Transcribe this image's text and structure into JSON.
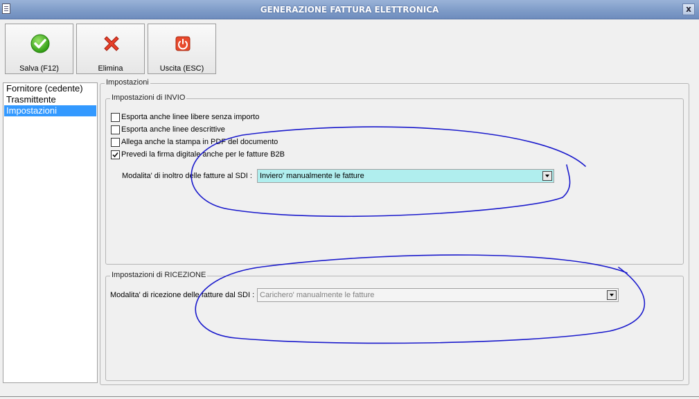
{
  "window": {
    "title": "GENERAZIONE FATTURA ELETTRONICA",
    "close_label": "x"
  },
  "toolbar": {
    "save_label": "Salva (F12)",
    "delete_label": "Elimina",
    "exit_label": "Uscita (ESC)"
  },
  "nav": {
    "items": [
      {
        "label": "Fornitore (cedente)",
        "selected": false
      },
      {
        "label": "Trasmittente",
        "selected": false
      },
      {
        "label": "Impostazioni",
        "selected": true
      }
    ]
  },
  "settings": {
    "group_title": "Impostazioni",
    "invio": {
      "title": "Impostazioni di INVIO",
      "options": [
        {
          "label": "Esporta anche linee libere senza importo",
          "checked": false
        },
        {
          "label": "Esporta anche linee descrittive",
          "checked": false
        },
        {
          "label": "Allega anche la stampa in PDF del documento",
          "checked": false
        },
        {
          "label": "Prevedi la firma digitale anche per le fatture B2B",
          "checked": true
        }
      ],
      "mode_label": "Modalita' di inoltro delle fatture al SDI :",
      "mode_value": "Inviero' manualmente le fatture"
    },
    "ricezione": {
      "title": "Impostazioni di RICEZIONE",
      "mode_label": "Modalita' di ricezione delle fatture dal SDI :",
      "mode_value": "Carichero' manualmente le fatture"
    }
  },
  "colors": {
    "invio_combo_bg": "#b0eeee",
    "ricezione_combo_text": "#808080",
    "annotation_ink": "#1a1acc",
    "selection": "#3399ff"
  }
}
